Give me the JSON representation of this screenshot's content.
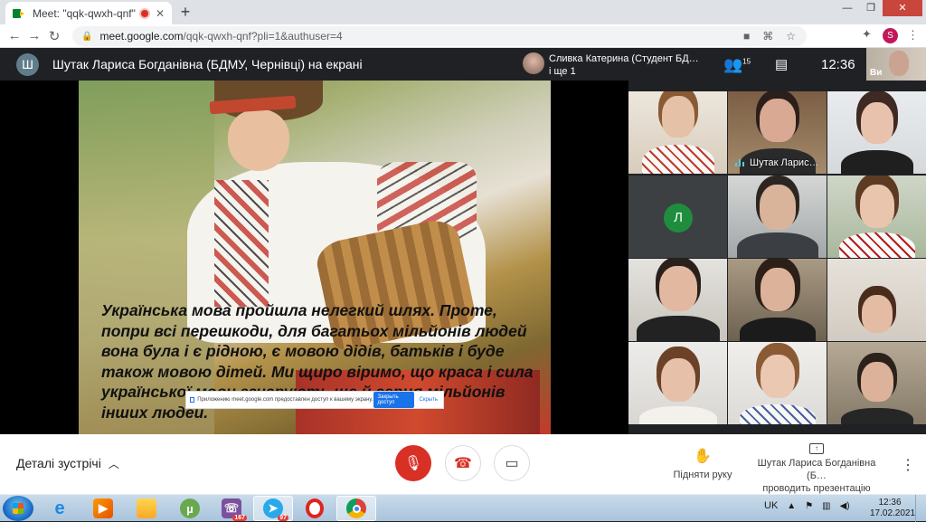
{
  "browser": {
    "tab_title": "Meet: \"qqk-qwxh-qnf\"",
    "tab_close": "✕",
    "new_tab": "+",
    "url_host": "meet.google.com",
    "url_path": "/qqk-qwxh-qnf?pli=1&authuser=4",
    "profile_initial": "S"
  },
  "meet_header": {
    "presenter_initial": "Ш",
    "presenter_title": "Шутак Лариса Богданівна (БДМУ, Чернівці) на екрані",
    "speaker_name": "Сливка Катерина (Студент БД…",
    "speaker_more": "і ще 1",
    "participants_count": "15",
    "time": "12:36",
    "self_label": "Ви"
  },
  "slide": {
    "text": "Українська мова пройшла нелегкий шлях. Проте, попри всі перешкоди, для багатьох мільйонів людей вона була і є рідною, є мовою дідів, батьків і буде також мовою дітей. Ми щиро віримо, що краса і сила української мови зачарують ще й серця мільйонів інших людей."
  },
  "share_notice": {
    "message": "Приложению meet.google.com предоставлен доступ к вашему экрану.",
    "stop_label": "Закрыть доступ",
    "hide_label": "Скрыть"
  },
  "grid": {
    "tiles": [
      {
        "name": ""
      },
      {
        "name": "Шутак Ларис…"
      },
      {
        "name": ""
      },
      {
        "name": "",
        "initial": "Л"
      },
      {
        "name": ""
      },
      {
        "name": ""
      },
      {
        "name": ""
      },
      {
        "name": ""
      },
      {
        "name": ""
      },
      {
        "name": ""
      },
      {
        "name": ""
      },
      {
        "name": ""
      }
    ]
  },
  "bottom_bar": {
    "details_label": "Деталі зустрічі",
    "raise_hand_label": "Підняти руку",
    "present_line1": "Шутак Лариса Богданівна (Б…",
    "present_line2": "проводить презентацію"
  },
  "taskbar": {
    "viber_badge": "167",
    "telegram_badge": "97",
    "lang": "UK",
    "time": "12:36",
    "date": "17.02.2021"
  },
  "colors": {
    "meet_dark": "#202124",
    "danger_red": "#d93025",
    "accent_blue": "#1a73e8",
    "avatar_green": "#1e8e3e"
  }
}
